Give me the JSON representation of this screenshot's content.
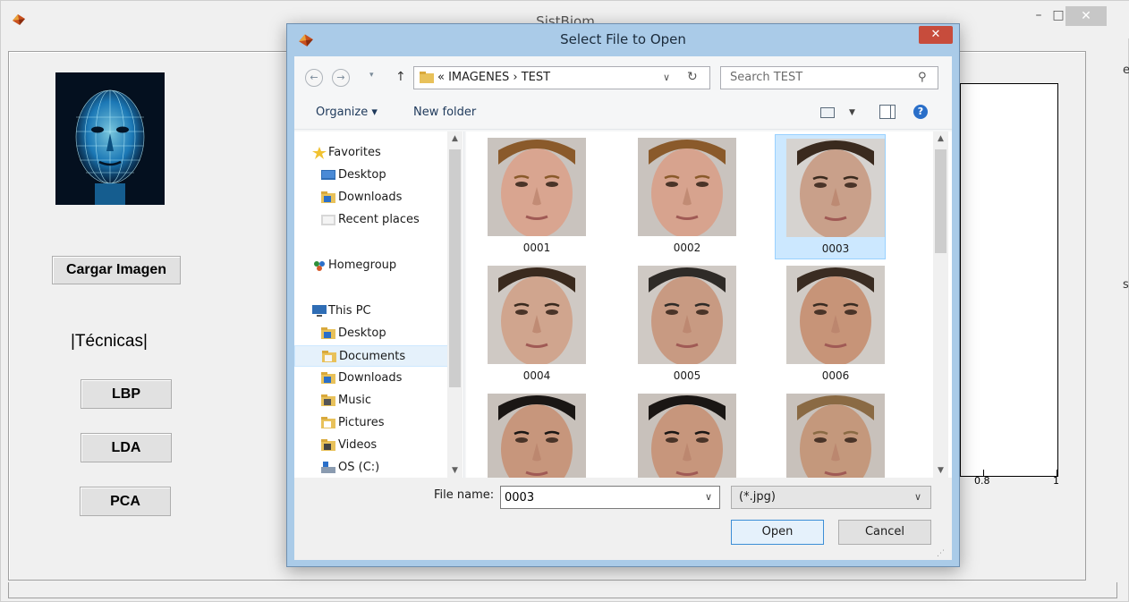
{
  "background_window": {
    "title": "SistBiom",
    "minimize_glyph": "–",
    "maximize_glyph": "□",
    "close_glyph": "✕",
    "load_image_button": "Cargar Imagen",
    "techniques_label": "|Técnicas|",
    "technique_buttons": [
      "LBP",
      "LDA",
      "PCA"
    ],
    "axis_tick_labels": [
      "0.8",
      "1"
    ],
    "edge_letters": [
      "e",
      "s"
    ]
  },
  "dialog": {
    "title": "Select File to Open",
    "close_glyph": "✕",
    "nav": {
      "back_glyph": "←",
      "forward_glyph": "→",
      "recent_glyph": "▾",
      "up_glyph": "↑",
      "address_path": "«  IMAGENES  ›  TEST",
      "address_drop_glyph": "∨",
      "refresh_glyph": "↻",
      "search_placeholder": "Search TEST",
      "search_glyph": "⚲"
    },
    "toolbar": {
      "organize_label": "Organize ▾",
      "new_folder_label": "New folder",
      "view_drop_glyph": "▼",
      "help_glyph": "?"
    },
    "nav_pane": {
      "items": [
        {
          "label": "Favorites",
          "kind": "top",
          "icon": "star-icon"
        },
        {
          "label": "Desktop",
          "kind": "child",
          "icon": "desktop-icon"
        },
        {
          "label": "Downloads",
          "kind": "child",
          "icon": "downloads-folder-icon"
        },
        {
          "label": "Recent places",
          "kind": "child",
          "icon": "recent-places-icon"
        },
        {
          "label": "Homegroup",
          "kind": "top",
          "icon": "homegroup-icon"
        },
        {
          "label": "This PC",
          "kind": "top",
          "icon": "computer-icon"
        },
        {
          "label": "Desktop",
          "kind": "child",
          "icon": "desktop-folder-icon"
        },
        {
          "label": "Documents",
          "kind": "child",
          "icon": "documents-folder-icon",
          "selected": true
        },
        {
          "label": "Downloads",
          "kind": "child",
          "icon": "downloads-folder-icon"
        },
        {
          "label": "Music",
          "kind": "child",
          "icon": "music-folder-icon"
        },
        {
          "label": "Pictures",
          "kind": "child",
          "icon": "pictures-folder-icon"
        },
        {
          "label": "Videos",
          "kind": "child",
          "icon": "videos-folder-icon"
        },
        {
          "label": "OS (C:)",
          "kind": "child",
          "icon": "drive-icon"
        }
      ]
    },
    "files": [
      {
        "name": "0001",
        "skin": "#d9a590",
        "hair": "#8a5a2b",
        "bg": "#c9c3be",
        "selected": false
      },
      {
        "name": "0002",
        "skin": "#d7a38e",
        "hair": "#8a5a2b",
        "bg": "#c9c3be",
        "selected": false
      },
      {
        "name": "0003",
        "skin": "#c9a08a",
        "hair": "#3a2a1e",
        "bg": "#d6d3d0",
        "selected": true
      },
      {
        "name": "0004",
        "skin": "#d0a58e",
        "hair": "#3a2a1e",
        "bg": "#cfc9c4",
        "selected": false
      },
      {
        "name": "0005",
        "skin": "#c89a82",
        "hair": "#2f2b27",
        "bg": "#cfc9c4",
        "selected": false
      },
      {
        "name": "0006",
        "skin": "#c79478",
        "hair": "#3a2c22",
        "bg": "#d0cbc6",
        "selected": false
      },
      {
        "name": "",
        "skin": "#c7967c",
        "hair": "#1a1614",
        "bg": "#c8c1bb",
        "selected": false
      },
      {
        "name": "",
        "skin": "#c7967c",
        "hair": "#1a1614",
        "bg": "#c8c1bb",
        "selected": false
      },
      {
        "name": "",
        "skin": "#c4987c",
        "hair": "#8a6a44",
        "bg": "#c8c1bb",
        "selected": false
      }
    ],
    "bottom": {
      "file_name_label": "File name:",
      "file_name_value": "0003",
      "file_name_drop_glyph": "∨",
      "filter_value": "(*.jpg)",
      "filter_drop_glyph": "∨",
      "open_label": "Open",
      "cancel_label": "Cancel"
    }
  },
  "colors": {
    "dialog_frame": "#aacbe8",
    "selection": "#cce8ff",
    "close_button": "#c74c3c",
    "matlab_chrome": "#f0f0f0"
  }
}
